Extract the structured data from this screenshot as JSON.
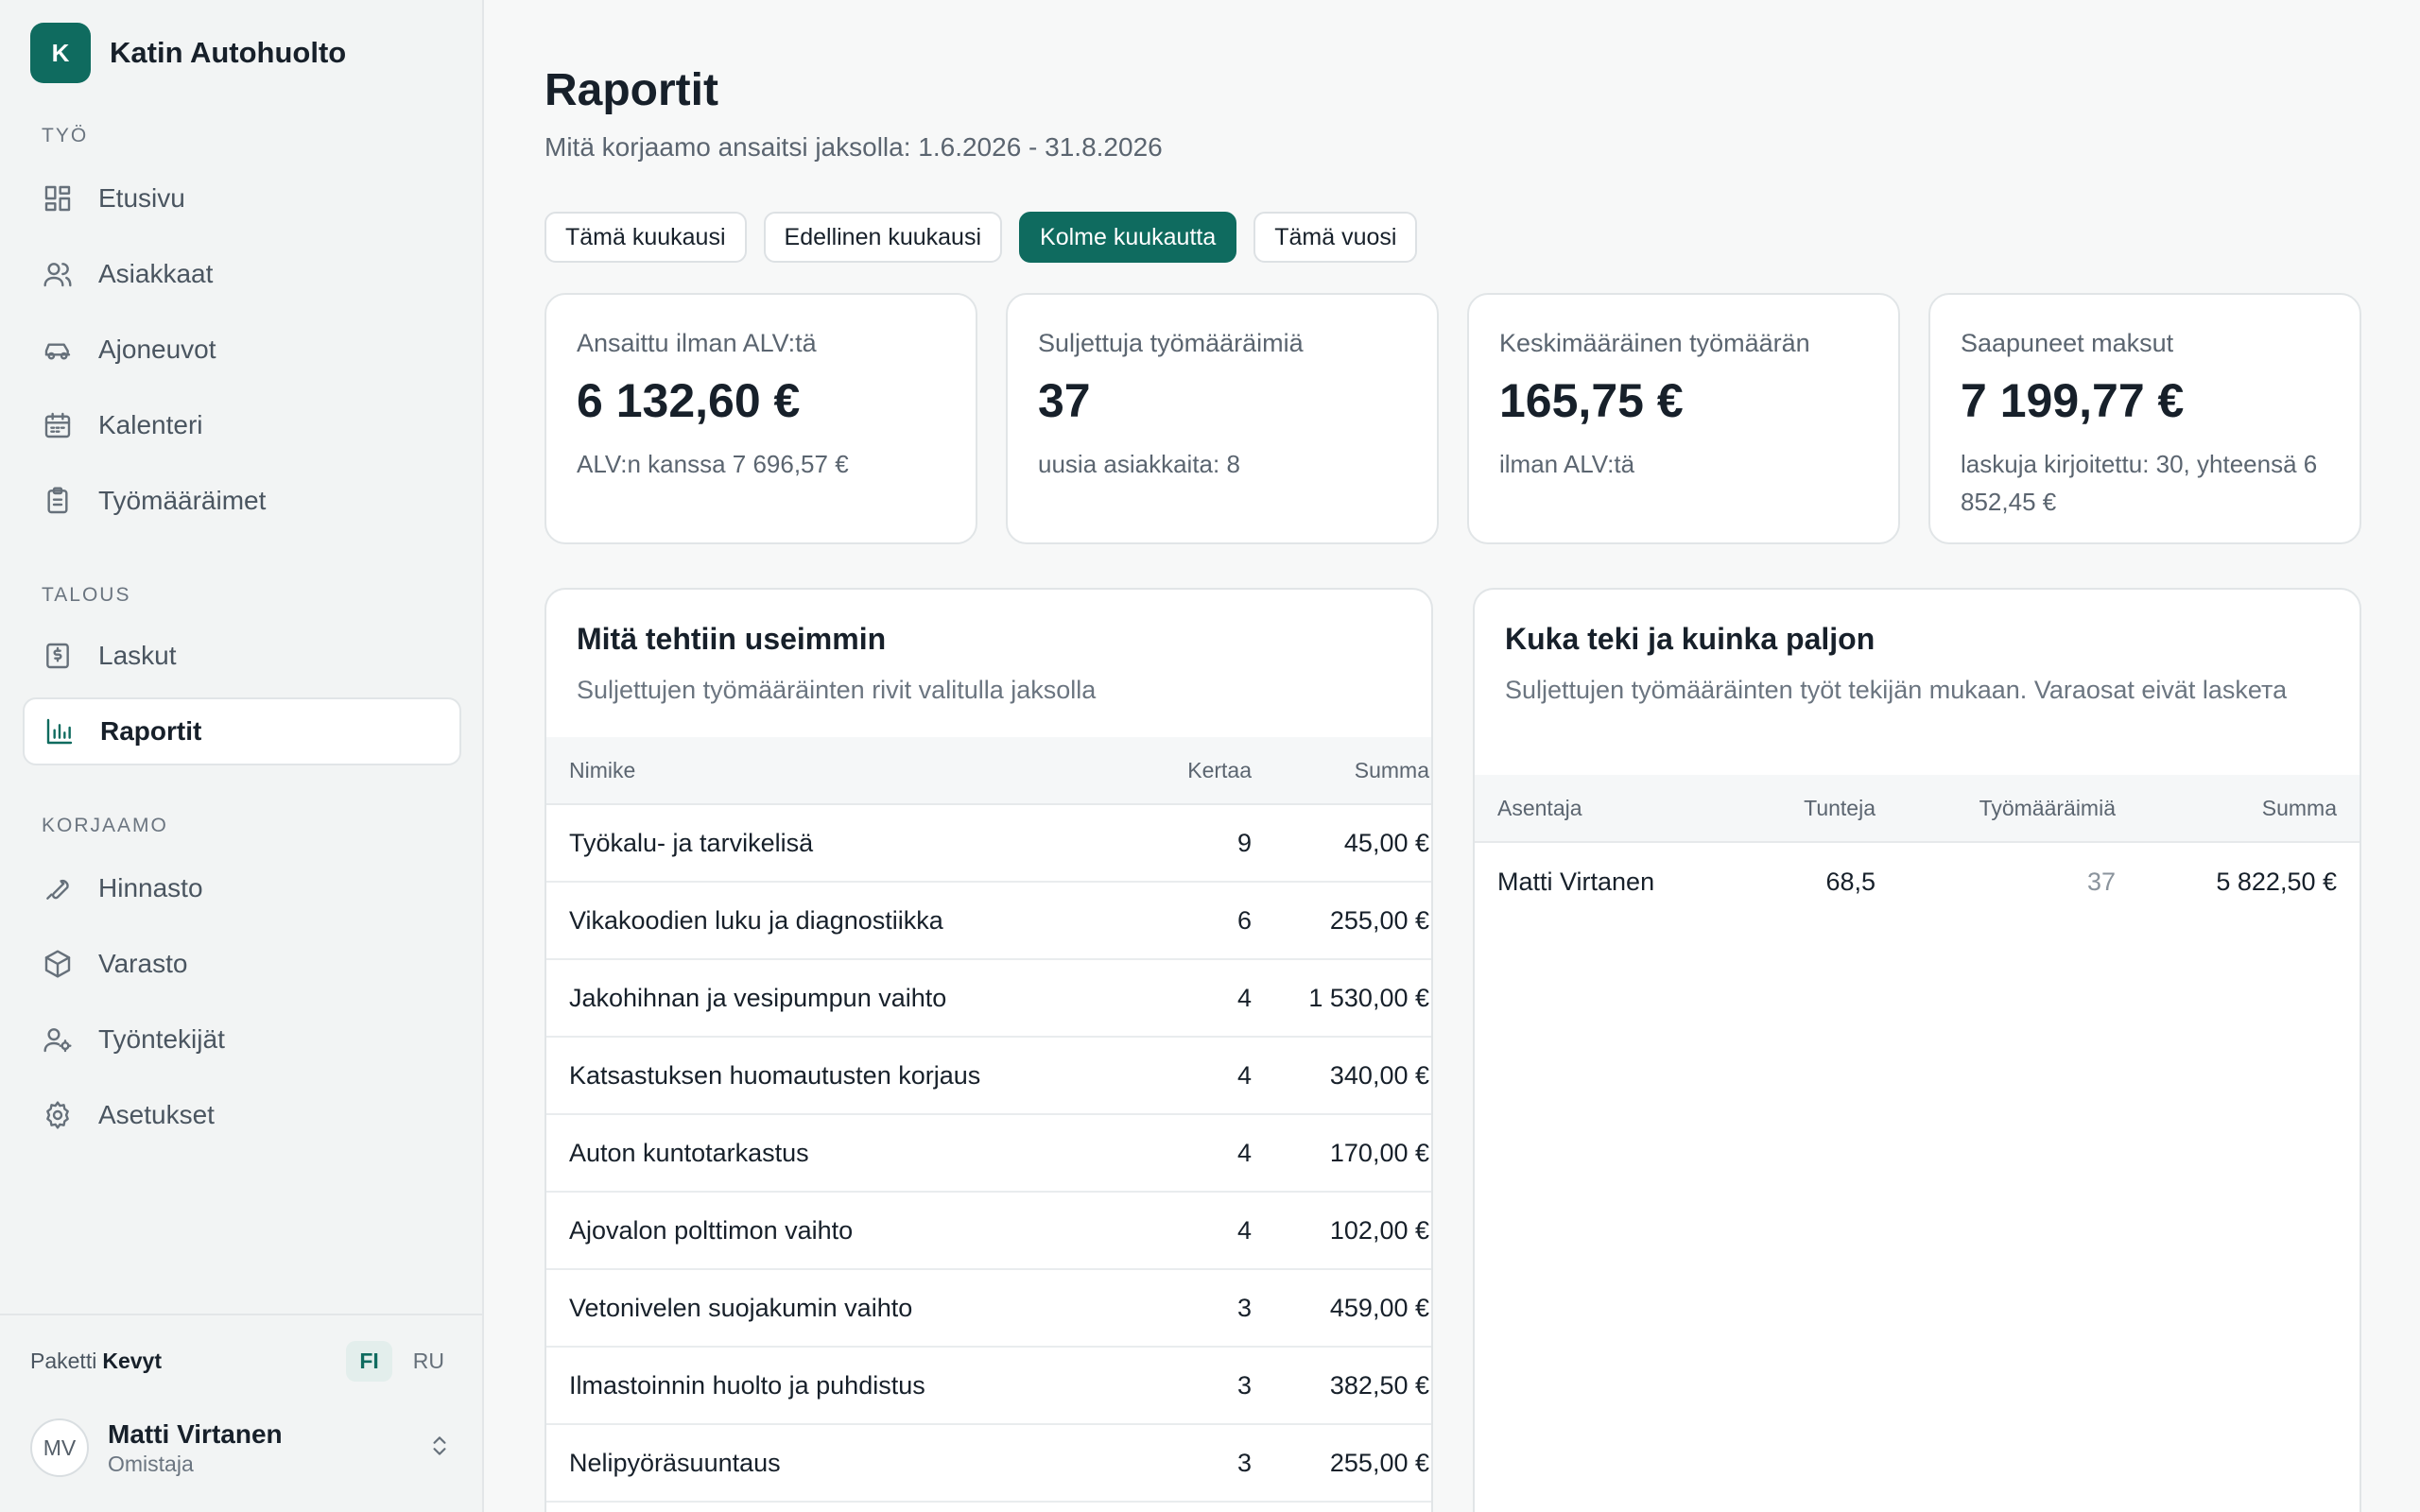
{
  "brand": {
    "initial": "K",
    "name": "Katin Autohuolto"
  },
  "sidebar": {
    "sections": [
      {
        "label": "TYÖ"
      },
      {
        "label": "TALOUS"
      },
      {
        "label": "KORJAAMO"
      }
    ],
    "items": [
      {
        "label": "Etusivu",
        "icon": "dashboard-icon"
      },
      {
        "label": "Asiakkaat",
        "icon": "users-icon"
      },
      {
        "label": "Ajoneuvot",
        "icon": "car-icon"
      },
      {
        "label": "Kalenteri",
        "icon": "calendar-icon"
      },
      {
        "label": "Työmääräimet",
        "icon": "clipboard-icon"
      },
      {
        "label": "Laskut",
        "icon": "invoice-icon"
      },
      {
        "label": "Raportit",
        "icon": "bar-chart-icon",
        "active": true
      },
      {
        "label": "Hinnasto",
        "icon": "wrench-icon"
      },
      {
        "label": "Varasto",
        "icon": "package-icon"
      },
      {
        "label": "Työntekijät",
        "icon": "user-cog-icon"
      },
      {
        "label": "Asetukset",
        "icon": "gear-icon"
      }
    ],
    "plan_prefix": "Paketti",
    "plan_name": "Kevyt",
    "languages": [
      "FI",
      "RU"
    ],
    "active_language": "FI",
    "user": {
      "initials": "MV",
      "name": "Matti Virtanen",
      "role": "Omistaja"
    }
  },
  "main": {
    "title": "Raportit",
    "subtitle": "Mitä korjaamo ansaitsi jaksolla: 1.6.2026 - 31.8.2026",
    "filters": [
      {
        "label": "Tämä kuukausi"
      },
      {
        "label": "Edellinen kuukausi"
      },
      {
        "label": "Kolme kuukautta",
        "active": true
      },
      {
        "label": "Tämä vuosi"
      }
    ],
    "kpis": [
      {
        "label": "Ansaittu ilman ALV:tä",
        "value": "6 132,60 €",
        "note": "ALV:n kanssa 7 696,57 €"
      },
      {
        "label": "Suljettuja työmääräimiä",
        "value": "37",
        "note": "uusia asiakkaita: 8"
      },
      {
        "label": "Keskimääräinen työmäärän",
        "value": "165,75 €",
        "note": "ilman ALV:tä"
      },
      {
        "label": "Saapuneet maksut",
        "value": "7 199,77 €",
        "note": "laskuja kirjoitettu: 30, yhteensä 6 852,45 €"
      }
    ],
    "top_jobs": {
      "title": "Mitä tehtiin useimmin",
      "subtitle": "Suljettujen työmääräinten rivit valitulla jaksolla",
      "columns": [
        "Nimike",
        "Kertaa",
        "Summa"
      ],
      "rows": [
        {
          "name": "Työkalu- ja tarvikelisä",
          "count": "9",
          "sum": "45,00 €"
        },
        {
          "name": "Vikakoodien luku ja diagnostiikka",
          "count": "6",
          "sum": "255,00 €"
        },
        {
          "name": "Jakohihnan ja vesipumpun vaihto",
          "count": "4",
          "sum": "1 530,00 €"
        },
        {
          "name": "Katsastuksen huomautusten korjaus",
          "count": "4",
          "sum": "340,00 €"
        },
        {
          "name": "Auton kuntotarkastus",
          "count": "4",
          "sum": "170,00 €"
        },
        {
          "name": "Ajovalon polttimon vaihto",
          "count": "4",
          "sum": "102,00 €"
        },
        {
          "name": "Vetonivelen suojakumin vaihto",
          "count": "3",
          "sum": "459,00 €"
        },
        {
          "name": "Ilmastoinnin huolto ja puhdistus",
          "count": "3",
          "sum": "382,50 €"
        },
        {
          "name": "Nelipyöräsuuntaus",
          "count": "3",
          "sum": "255,00 €"
        }
      ]
    },
    "by_worker": {
      "title": "Kuka teki ja kuinka paljon",
      "subtitle": "Suljettujen työmääräinten työt tekijän mukaan. Varaosat eivät laskета",
      "columns": [
        "Asentaja",
        "Tunteja",
        "Työmääräimiä",
        "Summa"
      ],
      "rows": [
        {
          "name": "Matti Virtanen",
          "hours": "68,5",
          "orders": "37",
          "sum": "5 822,50 €"
        }
      ]
    }
  }
}
